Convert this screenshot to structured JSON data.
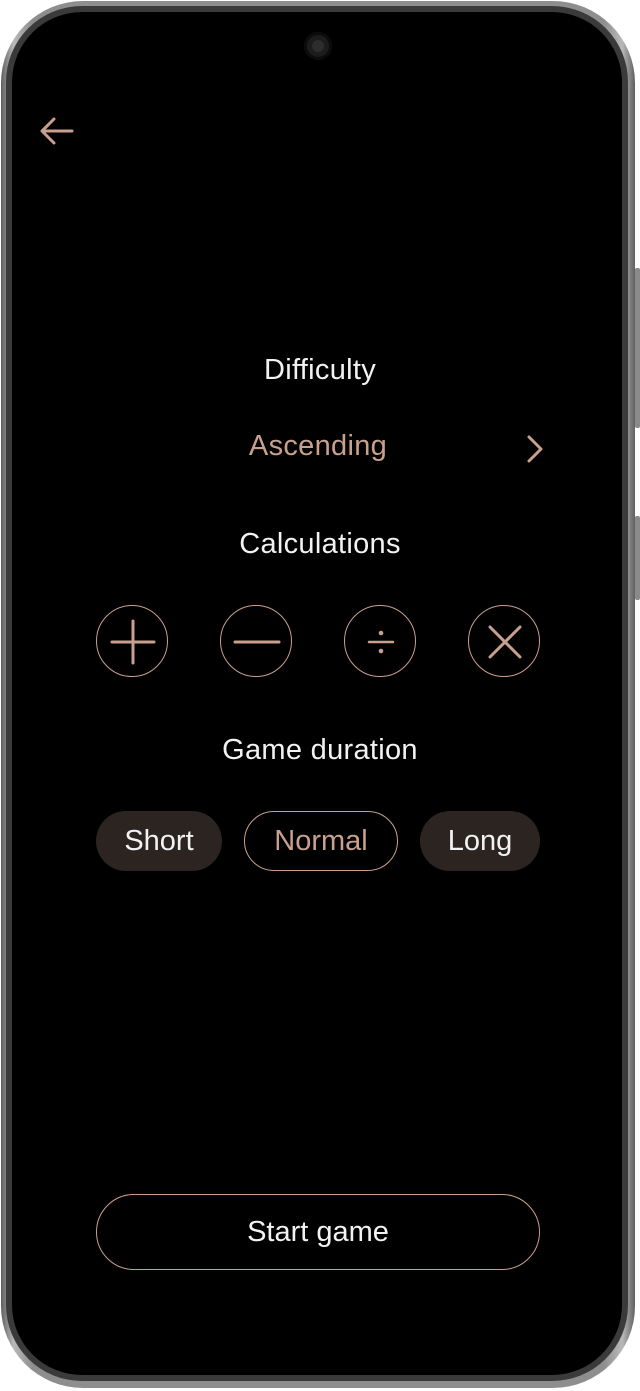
{
  "colors": {
    "accent": "#c9a08e",
    "text": "#f2f2f2",
    "pill_bg": "#2b2421",
    "screen_bg": "#000000"
  },
  "header": {
    "back_icon": "arrow-left-icon"
  },
  "difficulty": {
    "label": "Difficulty",
    "value": "Ascending",
    "chevron_icon": "chevron-right-icon"
  },
  "calculations": {
    "label": "Calculations",
    "operators": [
      {
        "name": "addition",
        "icon": "plus-icon"
      },
      {
        "name": "subtraction",
        "icon": "minus-icon"
      },
      {
        "name": "division",
        "icon": "divide-icon"
      },
      {
        "name": "multiplication",
        "icon": "times-icon"
      }
    ]
  },
  "duration": {
    "label": "Game duration",
    "options": [
      {
        "label": "Short",
        "selected": false
      },
      {
        "label": "Normal",
        "selected": true
      },
      {
        "label": "Long",
        "selected": false
      }
    ]
  },
  "start": {
    "label": "Start game"
  }
}
